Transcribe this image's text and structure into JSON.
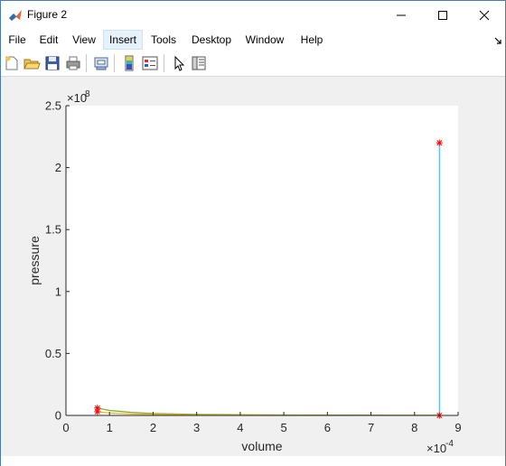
{
  "window": {
    "title": "Figure 2"
  },
  "menu": {
    "items": [
      {
        "label": "File"
      },
      {
        "label": "Edit"
      },
      {
        "label": "View"
      },
      {
        "label": "Insert"
      },
      {
        "label": "Tools"
      },
      {
        "label": "Desktop"
      },
      {
        "label": "Window"
      },
      {
        "label": "Help"
      }
    ]
  },
  "toolbar": {
    "buttons": [
      "new-figure-icon",
      "open-file-icon",
      "save-icon",
      "print-icon",
      "link-plot-icon",
      "insert-colorbar-icon",
      "insert-legend-icon",
      "edit-plot-icon",
      "property-inspector-icon"
    ]
  },
  "colors": {
    "line1": "#0072bd",
    "line2": "#d95319",
    "line3": "#edb120",
    "line4": "#77ac30",
    "line5": "#4dbeee",
    "marker": "#ff0000",
    "axes_bg": "#ffffff",
    "figure_bg": "#f0f0f0"
  },
  "chart_data": {
    "type": "line",
    "xlabel": "volume",
    "ylabel": "pressure",
    "x_exponent": "-4",
    "y_exponent": "8",
    "xlim": [
      0,
      9
    ],
    "ylim": [
      0,
      2.5
    ],
    "x_ticks": [
      "0",
      "1",
      "2",
      "3",
      "4",
      "5",
      "6",
      "7",
      "8",
      "9"
    ],
    "y_ticks": [
      "0",
      "0.5",
      "1",
      "1.5",
      "2",
      "2.5"
    ],
    "x_tick_values": [
      0,
      1,
      2,
      3,
      4,
      5,
      6,
      7,
      8,
      9
    ],
    "y_tick_values": [
      0,
      0.5,
      1,
      1.5,
      2,
      2.5
    ],
    "grid": false,
    "series": [
      {
        "x": [
          0.72,
          1.0,
          1.5,
          2.0,
          3.0,
          4.0,
          5.0,
          6.0,
          7.0,
          8.0,
          8.57
        ],
        "y": [
          0.06,
          0.04,
          0.025,
          0.016,
          0.009,
          0.006,
          0.004,
          0.003,
          0.002,
          0.0018,
          0.0015
        ],
        "color": "line4"
      },
      {
        "x": [
          0.72,
          1.0,
          1.5,
          2.0,
          3.0,
          4.0,
          5.0,
          6.0,
          7.0,
          8.0,
          8.57
        ],
        "y": [
          0.03,
          0.02,
          0.012,
          0.008,
          0.004,
          0.003,
          0.002,
          0.0015,
          0.001,
          0.0008,
          0.0006
        ],
        "color": "line3"
      },
      {
        "x": [
          0.72,
          0.72
        ],
        "y": [
          0.03,
          0.06
        ],
        "color": "line2"
      },
      {
        "x": [
          8.57,
          8.57
        ],
        "y": [
          0.0,
          2.2
        ],
        "color": "line5"
      }
    ],
    "markers": [
      {
        "x": 0.72,
        "y": 0.06
      },
      {
        "x": 0.72,
        "y": 0.03
      },
      {
        "x": 8.57,
        "y": 2.2
      },
      {
        "x": 8.57,
        "y": 0.0
      }
    ]
  }
}
